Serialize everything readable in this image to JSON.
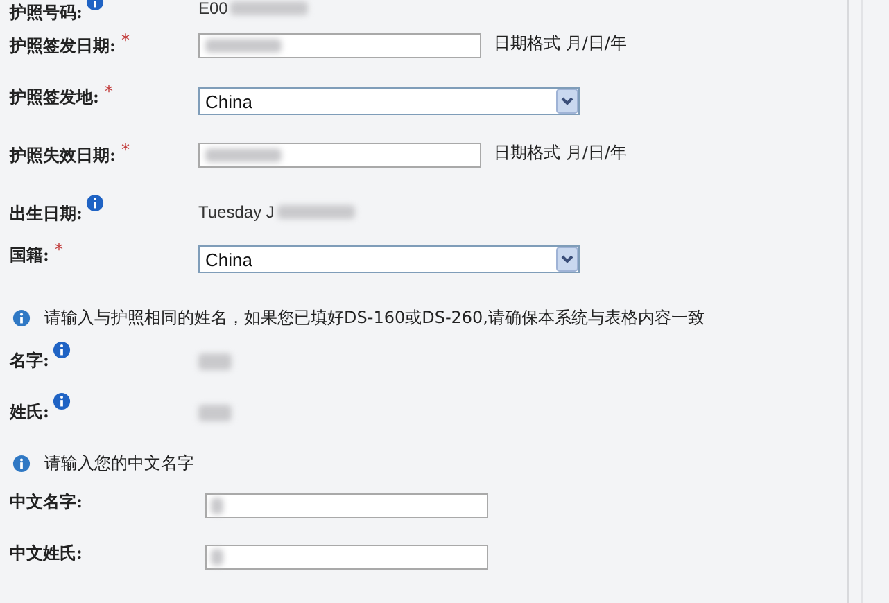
{
  "form": [
    {
      "kind": "text",
      "label": "护照号码:",
      "info": true,
      "value": "E00"
    },
    {
      "kind": "date",
      "label": "护照签发日期:",
      "info": false,
      "required_mark": "*",
      "hint": "日期格式  月/日/年"
    },
    {
      "kind": "select",
      "label": "护照签发地:",
      "info": false,
      "required_mark": "*",
      "value": "China"
    },
    {
      "kind": "date",
      "label": "护照失效日期:",
      "info": false,
      "required_mark": "*",
      "hint": "日期格式  月/日/年"
    },
    {
      "kind": "text",
      "label": "出生日期:",
      "info": true,
      "value": "Tuesday J"
    },
    {
      "kind": "select",
      "label": "国籍:",
      "info": false,
      "required_mark": "*",
      "value": "China"
    },
    {
      "kind": "note",
      "text": "请输入与护照相同的姓名，如果您已填好DS-160或DS-260,请确保本系统与表格内容一致"
    },
    {
      "kind": "hidden",
      "label": "名字:",
      "info": true
    },
    {
      "kind": "hidden",
      "label": "姓氏:",
      "info": true
    },
    {
      "kind": "note",
      "text": "请输入您的中文名字"
    },
    {
      "kind": "input",
      "label": "中文名字:",
      "info": false
    },
    {
      "kind": "input",
      "label": "中文姓氏:",
      "info": false
    }
  ]
}
